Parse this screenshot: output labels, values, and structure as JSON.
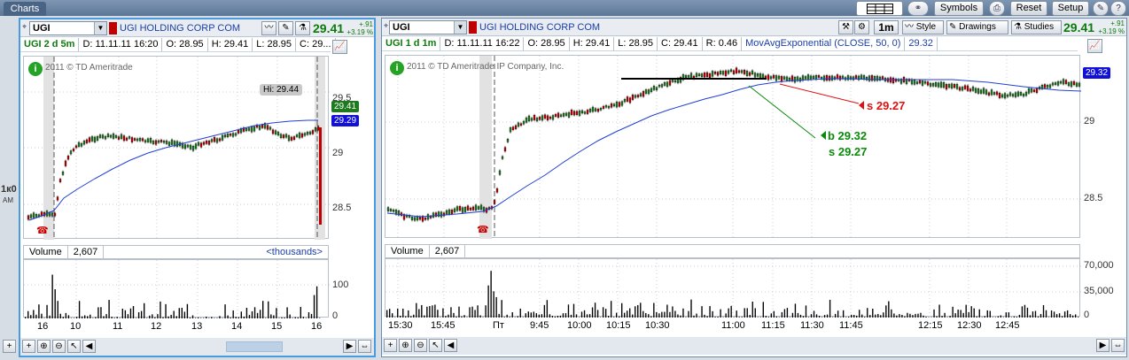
{
  "window": {
    "title": "Charts"
  },
  "toolbar": {
    "symbols_label": "Symbols",
    "reset_label": "Reset",
    "setup_label": "Setup"
  },
  "left_chart": {
    "symbol": "UGI",
    "company": "UGI HOLDING CORP COM",
    "last": "29.41",
    "change": "+.91",
    "change_pct": "+3.19 %",
    "info": {
      "label": "UGI 2 d 5m",
      "date": "D: 11.11.11 16:20",
      "open": "O: 28.95",
      "high": "H: 29.41",
      "low": "L: 28.95",
      "close": "C: 29..."
    },
    "copyright": "2011 © TD Ameritrade",
    "hi_label": "Hi: 29.44",
    "y_ticks": [
      "29.5",
      "29",
      "28.5"
    ],
    "price_tags": {
      "last": "29.41",
      "ma": "29.29"
    },
    "x_ticks": [
      "16",
      "10",
      "11",
      "12",
      "13",
      "14",
      "15",
      "16"
    ],
    "volume": {
      "label": "Volume",
      "value": "2,607",
      "units": "<thousands>",
      "ticks": [
        "100",
        "0"
      ]
    }
  },
  "right_chart": {
    "symbol": "UGI",
    "company": "UGI HOLDING CORP COM",
    "last": "29.41",
    "change": "+.91",
    "change_pct": "+3.19 %",
    "interval": "1m",
    "style_label": "Style",
    "drawings_label": "Drawings",
    "studies_label": "Studies",
    "info": {
      "label": "UGI 1 d 1m",
      "date": "D: 11.11.11 16:22",
      "open": "O: 28.95",
      "high": "H: 29.41",
      "low": "L: 28.95",
      "close": "C: 29.41",
      "range": "R: 0.46",
      "study": "MovAvgExponential (CLOSE, 50, 0)",
      "study_value": "29.32"
    },
    "copyright": "2011 © TD Ameritrade IP Company, Inc.",
    "y_ticks": [
      "29",
      "28.5"
    ],
    "price_tags": {
      "ma": "29.32"
    },
    "annotations": {
      "sell_red": "s 29.27",
      "buy": "b 29.32",
      "sell_green": "s 29.27"
    },
    "x_ticks": [
      "15:30",
      "15:45",
      "Пт",
      "9:45",
      "10:00",
      "10:15",
      "10:30",
      "11:00",
      "11:15",
      "11:30",
      "11:45",
      "12:15",
      "12:30",
      "12:45"
    ],
    "volume": {
      "label": "Volume",
      "value": "2,607",
      "ticks": [
        "70,000",
        "35,000",
        "0"
      ]
    }
  },
  "edge_text": {
    "top": "1к0",
    "bottom": "AM"
  },
  "colors": {
    "up": "#1e7a1e",
    "down": "#c00000",
    "ma": "#1f3fd6",
    "last_tag": "#1e7a1e",
    "ma_tag": "#1010d8",
    "sell": "#e01010",
    "buy": "#0a8a0a"
  }
}
